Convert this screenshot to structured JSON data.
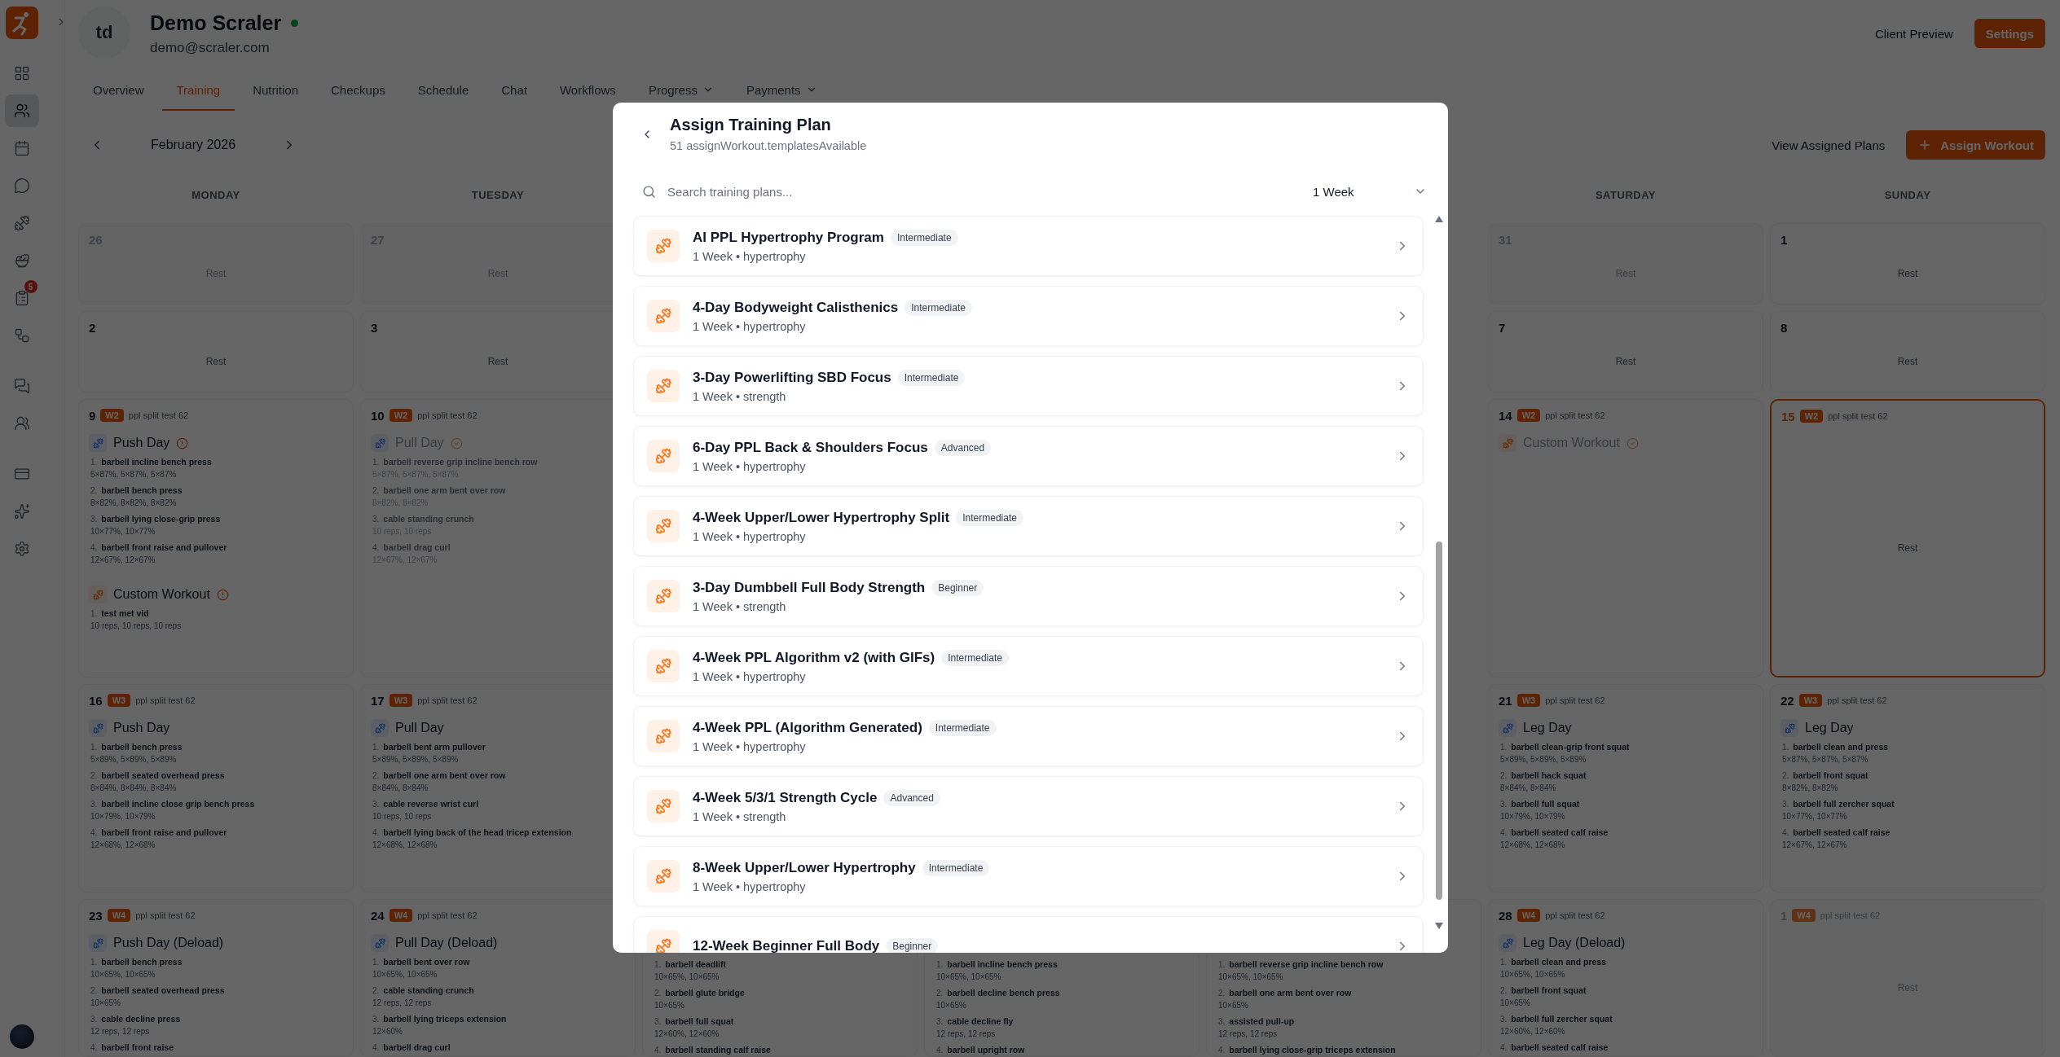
{
  "sidebar": {
    "groups": [
      {
        "items": [
          {
            "kind": "grid",
            "selected": false
          },
          {
            "kind": "clients",
            "selected": true
          },
          {
            "kind": "calendar",
            "selected": false
          },
          {
            "kind": "chat",
            "selected": false
          },
          {
            "kind": "dumbbell",
            "selected": false
          },
          {
            "kind": "salad",
            "selected": false
          },
          {
            "kind": "clipboard",
            "selected": false,
            "badge": "5"
          },
          {
            "kind": "workflow",
            "selected": false
          }
        ]
      },
      {
        "items": [
          {
            "kind": "messages",
            "selected": false
          },
          {
            "kind": "team",
            "selected": false
          }
        ]
      },
      {
        "items": [
          {
            "kind": "card",
            "selected": false
          },
          {
            "kind": "sparkles",
            "selected": false
          },
          {
            "kind": "settings",
            "selected": false
          }
        ]
      }
    ]
  },
  "client": {
    "avatar": "td",
    "name": "Demo Scraler",
    "online": true,
    "email": "demo@scraler.com"
  },
  "header_actions": [
    {
      "label": "Client Preview",
      "kind": "ghost"
    },
    {
      "label": "Settings",
      "kind": "primary"
    }
  ],
  "tabs": [
    {
      "label": "Overview",
      "selected": false
    },
    {
      "label": "Training",
      "selected": true
    },
    {
      "label": "Nutrition",
      "selected": false
    },
    {
      "label": "Checkups",
      "selected": false
    },
    {
      "label": "Schedule",
      "selected": false
    },
    {
      "label": "Chat",
      "selected": false
    },
    {
      "label": "Workflows",
      "selected": false
    },
    {
      "label": "Progress",
      "selected": false,
      "dropdown": true
    },
    {
      "label": "Payments",
      "selected": false,
      "dropdown": true
    }
  ],
  "toolbar": {
    "month": "February 2026",
    "actions": [
      {
        "label": "View Assigned Plans",
        "kind": "ghost"
      },
      {
        "label": "Assign Workout",
        "kind": "add"
      }
    ]
  },
  "weekdays": [
    {
      "label": "MONDAY"
    },
    {
      "label": "TUESDAY"
    },
    {
      "label": "SATURDAY"
    },
    {
      "label": "SUNDAY"
    }
  ],
  "weeks": [
    {
      "days": [
        {
          "day": "26",
          "muted": true,
          "rest": "Rest"
        },
        {
          "day": "27",
          "muted": true,
          "rest": "Rest"
        },
        {
          "day": "31",
          "muted": true,
          "rest": "Rest"
        },
        {
          "day": "1",
          "muted": false,
          "rest": "Rest"
        }
      ]
    },
    {
      "days": [
        {
          "day": "2",
          "muted": false,
          "rest": "Rest"
        },
        {
          "day": "3",
          "muted": false,
          "rest": "Rest"
        },
        {
          "day": "7",
          "muted": false,
          "rest": "Rest"
        },
        {
          "day": "8",
          "muted": false,
          "rest": "Rest"
        }
      ]
    },
    {
      "days": [
        {
          "day": "9",
          "week": "W2",
          "plan": "ppl split test 62",
          "muted": false,
          "workouts": [
            {
              "title": "Push Day",
              "kind": "program",
              "completed": false,
              "exercises": [
                {
                  "num": "1.",
                  "name": "barbell incline bench press",
                  "sets": "5×87%, 5×87%, 5×87%"
                },
                {
                  "num": "2.",
                  "name": "barbell bench press",
                  "sets": "8×82%, 8×82%, 8×82%"
                },
                {
                  "num": "3.",
                  "name": "barbell lying close-grip press",
                  "sets": "10×77%, 10×77%"
                },
                {
                  "num": "4.",
                  "name": "barbell front raise and pullover",
                  "sets": "12×67%, 12×67%"
                }
              ]
            },
            {
              "title": "Custom Workout",
              "kind": "custom",
              "completed": false,
              "exercises": [
                {
                  "num": "1.",
                  "name": "test met vid",
                  "sets": "10 reps, 10 reps, 10 reps"
                }
              ]
            }
          ]
        },
        {
          "day": "10",
          "week": "W2",
          "plan": "ppl split test 62",
          "muted": false,
          "workouts": [
            {
              "title": "Pull Day",
              "kind": "program",
              "completed": true,
              "exercises": [
                {
                  "num": "1.",
                  "name": "barbell reverse grip incline bench row",
                  "sets": "5×87%, 5×87%, 5×87%"
                },
                {
                  "num": "2.",
                  "name": "barbell one arm bent over row",
                  "sets": "8×82%, 8×82%"
                },
                {
                  "num": "3.",
                  "name": "cable standing crunch",
                  "sets": "10 reps, 10 reps"
                },
                {
                  "num": "4.",
                  "name": "barbell drag curl",
                  "sets": "12×67%, 12×67%"
                }
              ]
            }
          ]
        },
        {
          "day": "14",
          "week": "W2",
          "plan": "ppl split test 62",
          "muted": false,
          "workouts": [
            {
              "title": "Custom Workout",
              "kind": "custom",
              "completed": true
            }
          ]
        },
        {
          "day": "15",
          "week": "W2",
          "plan": "ppl split test 62",
          "muted": false,
          "today": true,
          "rest": "Rest"
        }
      ]
    },
    {
      "days": [
        {
          "day": "16",
          "week": "W3",
          "plan": "ppl split test 62",
          "muted": false,
          "workouts": [
            {
              "title": "Push Day",
              "kind": "program",
              "exercises": [
                {
                  "num": "1.",
                  "name": "barbell bench press",
                  "sets": "5×89%, 5×89%, 5×89%"
                },
                {
                  "num": "2.",
                  "name": "barbell seated overhead press",
                  "sets": "8×84%, 8×84%, 8×84%"
                },
                {
                  "num": "3.",
                  "name": "barbell incline close grip bench press",
                  "sets": "10×79%, 10×79%"
                },
                {
                  "num": "4.",
                  "name": "barbell front raise and pullover",
                  "sets": "12×68%, 12×68%"
                }
              ]
            }
          ]
        },
        {
          "day": "17",
          "week": "W3",
          "plan": "ppl split test 62",
          "muted": false,
          "workouts": [
            {
              "title": "Pull Day",
              "kind": "program",
              "exercises": [
                {
                  "num": "1.",
                  "name": "barbell bent arm pullover",
                  "sets": "5×89%, 5×89%, 5×89%"
                },
                {
                  "num": "2.",
                  "name": "barbell one arm bent over row",
                  "sets": "8×84%, 8×84%"
                },
                {
                  "num": "3.",
                  "name": "cable reverse wrist curl",
                  "sets": "10 reps, 10 reps"
                },
                {
                  "num": "4.",
                  "name": "barbell lying back of the head tricep extension",
                  "sets": "12×68%, 12×68%"
                }
              ]
            }
          ]
        },
        {
          "day": "21",
          "week": "W3",
          "plan": "ppl split test 62",
          "muted": false,
          "workouts": [
            {
              "title": "Leg Day",
              "kind": "program",
              "exercises": [
                {
                  "num": "1.",
                  "name": "barbell clean-grip front squat",
                  "sets": "5×89%, 5×89%, 5×89%"
                },
                {
                  "num": "2.",
                  "name": "barbell hack squat",
                  "sets": "8×84%, 8×84%"
                },
                {
                  "num": "3.",
                  "name": "barbell full squat",
                  "sets": "10×79%, 10×79%"
                },
                {
                  "num": "4.",
                  "name": "barbell seated calf raise",
                  "sets": "12×68%, 12×68%"
                }
              ]
            }
          ]
        },
        {
          "day": "22",
          "week": "W3",
          "plan": "ppl split test 62",
          "muted": false,
          "workouts": [
            {
              "title": "Leg Day",
              "kind": "program",
              "exercises": [
                {
                  "num": "1.",
                  "name": "barbell clean and press",
                  "sets": "5×87%, 5×87%, 5×87%"
                },
                {
                  "num": "2.",
                  "name": "barbell front squat",
                  "sets": "8×82%, 8×82%"
                },
                {
                  "num": "3.",
                  "name": "barbell full zercher squat",
                  "sets": "10×77%, 10×77%"
                },
                {
                  "num": "4.",
                  "name": "barbell seated calf raise",
                  "sets": "12×67%, 12×67%"
                }
              ]
            }
          ]
        }
      ]
    },
    {
      "days": [
        {
          "day": "23",
          "week": "W4",
          "plan": "ppl split test 62",
          "muted": false,
          "workouts": [
            {
              "title": "Push Day (Deload)",
              "kind": "program",
              "exercises": [
                {
                  "num": "1.",
                  "name": "barbell bench press",
                  "sets": "10×65%, 10×65%"
                },
                {
                  "num": "2.",
                  "name": "barbell seated overhead press",
                  "sets": "10×65%"
                },
                {
                  "num": "3.",
                  "name": "cable decline press",
                  "sets": "12 reps, 12 reps"
                },
                {
                  "num": "4.",
                  "name": "barbell front raise"
                }
              ]
            }
          ]
        },
        {
          "day": "24",
          "week": "W4",
          "plan": "ppl split test 62",
          "muted": false,
          "workouts": [
            {
              "title": "Pull Day (Deload)",
              "kind": "program",
              "exercises": [
                {
                  "num": "1.",
                  "name": "barbell bent over row",
                  "sets": "10×65%, 10×65%"
                },
                {
                  "num": "2.",
                  "name": "cable standing crunch",
                  "sets": "12 reps, 12 reps"
                },
                {
                  "num": "3.",
                  "name": "barbell lying triceps extension",
                  "sets": "12×60%"
                },
                {
                  "num": "4.",
                  "name": "barbell drag curl"
                }
              ]
            }
          ]
        },
        {
          "workouts": [
            {
              "exercises": [
                {
                  "num": "1.",
                  "name": "barbell deadlift",
                  "sets": "10×65%, 10×65%"
                },
                {
                  "num": "2.",
                  "name": "barbell glute bridge",
                  "sets": "10×65%"
                },
                {
                  "num": "3.",
                  "name": "barbell full squat",
                  "sets": "12×60%, 12×60%"
                },
                {
                  "num": "4.",
                  "name": "barbell standing calf raise"
                }
              ]
            }
          ]
        },
        {
          "workouts": [
            {
              "exercises": [
                {
                  "num": "1.",
                  "name": "barbell incline bench press",
                  "sets": "10×65%, 10×65%"
                },
                {
                  "num": "2.",
                  "name": "barbell decline bench press",
                  "sets": "10×65%"
                },
                {
                  "num": "3.",
                  "name": "cable decline fly",
                  "sets": "12 reps, 12 reps"
                },
                {
                  "num": "4.",
                  "name": "barbell upright row"
                }
              ]
            }
          ]
        },
        {
          "workouts": [
            {
              "exercises": [
                {
                  "num": "1.",
                  "name": "barbell reverse grip incline bench row",
                  "sets": "10×65%, 10×65%"
                },
                {
                  "num": "2.",
                  "name": "barbell one arm bent over row",
                  "sets": "10×65%"
                },
                {
                  "num": "3.",
                  "name": "assisted pull-up",
                  "sets": "12 reps, 12 reps"
                },
                {
                  "num": "4.",
                  "name": "barbell lying close-grip triceps extension"
                }
              ]
            }
          ]
        },
        {
          "day": "28",
          "week": "W4",
          "plan": "ppl split test 62",
          "muted": false,
          "workouts": [
            {
              "title": "Leg Day (Deload)",
              "kind": "program",
              "exercises": [
                {
                  "num": "1.",
                  "name": "barbell clean and press",
                  "sets": "10×65%, 10×65%"
                },
                {
                  "num": "2.",
                  "name": "barbell front squat",
                  "sets": "10×65%"
                },
                {
                  "num": "3.",
                  "name": "barbell full zercher squat",
                  "sets": "12×60%, 12×60%"
                },
                {
                  "num": "4.",
                  "name": "barbell seated calf raise"
                }
              ]
            }
          ]
        },
        {
          "day": "1",
          "week": "W4",
          "plan": "ppl split test 62",
          "muted": true,
          "rest": "Rest"
        }
      ]
    }
  ],
  "modal": {
    "title": "Assign Training Plan",
    "subtitle": "51 assignWorkout.templatesAvailable",
    "search": {
      "placeholder": "Search training plans..."
    },
    "duration": "1 Week",
    "plans": [
      {
        "name": "AI PPL Hypertrophy Program",
        "level": "Intermediate",
        "meta": "1 Week • hypertrophy"
      },
      {
        "name": "4-Day Bodyweight Calisthenics",
        "level": "Intermediate",
        "meta": "1 Week • hypertrophy"
      },
      {
        "name": "3-Day Powerlifting SBD Focus",
        "level": "Intermediate",
        "meta": "1 Week • strength"
      },
      {
        "name": "6-Day PPL Back & Shoulders Focus",
        "level": "Advanced",
        "meta": "1 Week • hypertrophy"
      },
      {
        "name": "4-Week Upper/Lower Hypertrophy Split",
        "level": "Intermediate",
        "meta": "1 Week • hypertrophy"
      },
      {
        "name": "3-Day Dumbbell Full Body Strength",
        "level": "Beginner",
        "meta": "1 Week • strength"
      },
      {
        "name": "4-Week PPL Algorithm v2 (with GIFs)",
        "level": "Intermediate",
        "meta": "1 Week • hypertrophy"
      },
      {
        "name": "4-Week PPL (Algorithm Generated)",
        "level": "Intermediate",
        "meta": "1 Week • hypertrophy"
      },
      {
        "name": "4-Week 5/3/1 Strength Cycle",
        "level": "Advanced",
        "meta": "1 Week • strength"
      },
      {
        "name": "8-Week Upper/Lower Hypertrophy",
        "level": "Intermediate",
        "meta": "1 Week • hypertrophy"
      },
      {
        "name": "12-Week Beginner Full Body",
        "level": "Beginner"
      }
    ]
  }
}
